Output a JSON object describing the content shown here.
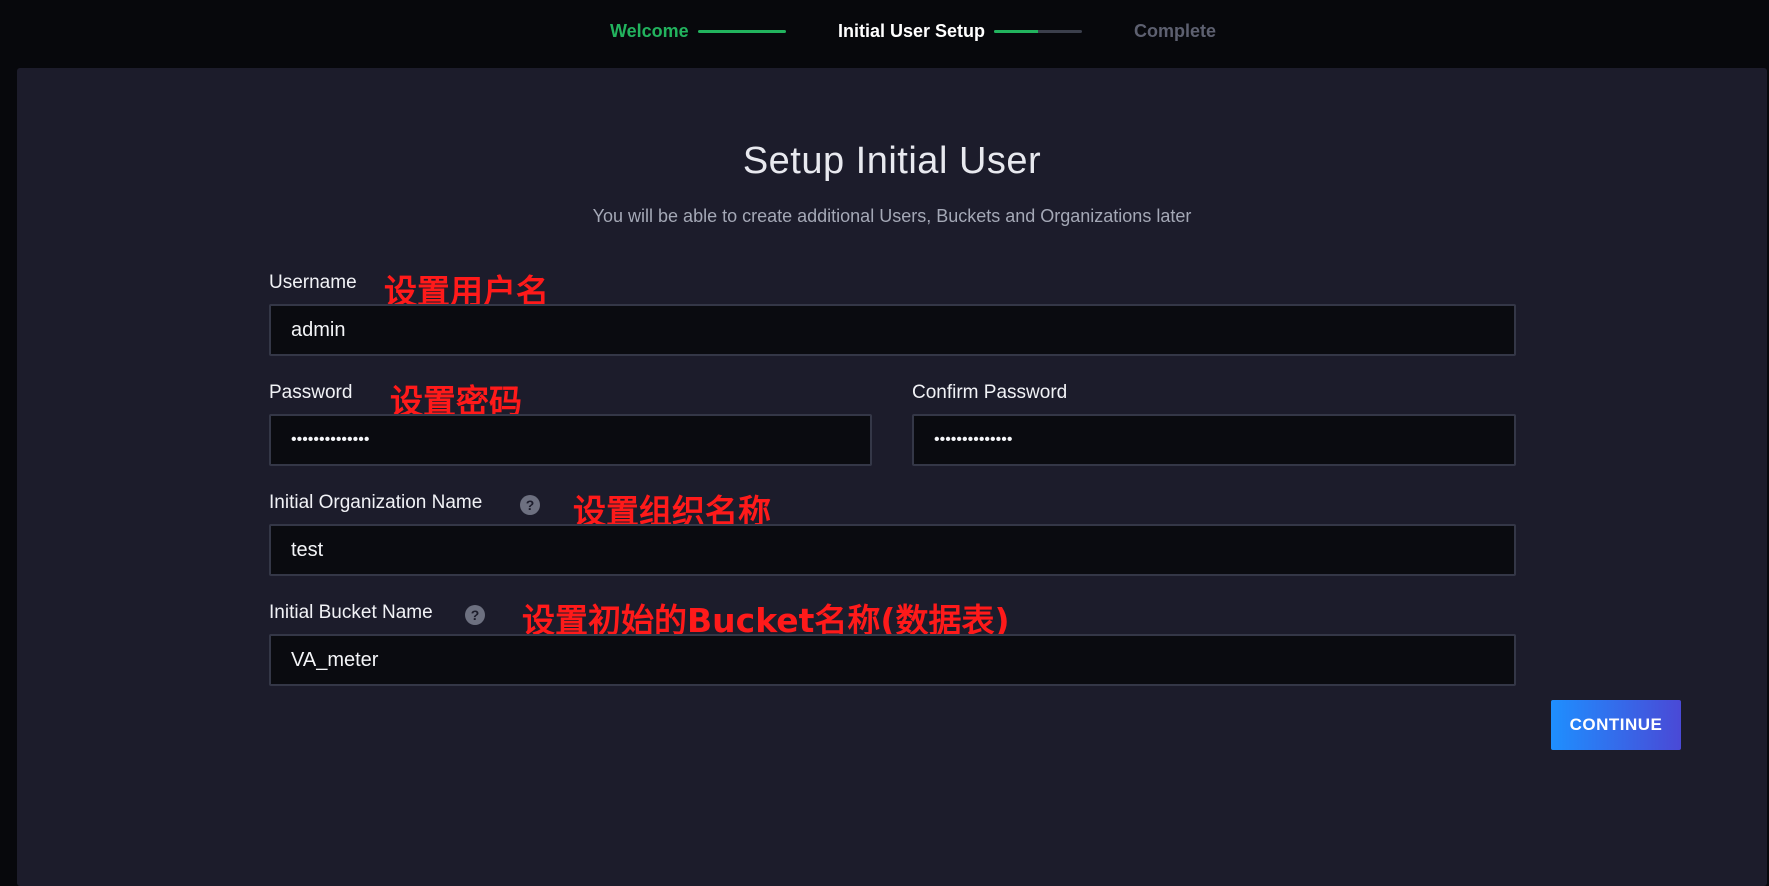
{
  "stepper": {
    "steps": [
      {
        "label": "Welcome",
        "state": "done",
        "progress": 1.0
      },
      {
        "label": "Initial User Setup",
        "state": "active",
        "progress": 0.5
      },
      {
        "label": "Complete",
        "state": "todo"
      }
    ]
  },
  "form": {
    "title": "Setup Initial User",
    "subtitle": "You will be able to create additional Users, Buckets and Organizations later",
    "username": {
      "label": "Username",
      "value": "admin",
      "note": "设置用户名"
    },
    "password": {
      "label": "Password",
      "value": "••••••••••••••",
      "note": "设置密码"
    },
    "confirm_password": {
      "label": "Confirm Password",
      "value": "••••••••••••••"
    },
    "organization": {
      "label": "Initial Organization Name",
      "value": "test",
      "help_icon": "?",
      "note": "设置组织名称"
    },
    "bucket": {
      "label": "Initial Bucket Name",
      "value": "VA_meter",
      "help_icon": "?",
      "note": "设置初始的Bucket名称(数据表)"
    },
    "continue_label": "CONTINUE"
  },
  "colors": {
    "accent_green": "#22b35e",
    "annotation_red": "#ff1a1a",
    "button_gradient_start": "#1e8fff",
    "button_gradient_end": "#4a49d6"
  }
}
